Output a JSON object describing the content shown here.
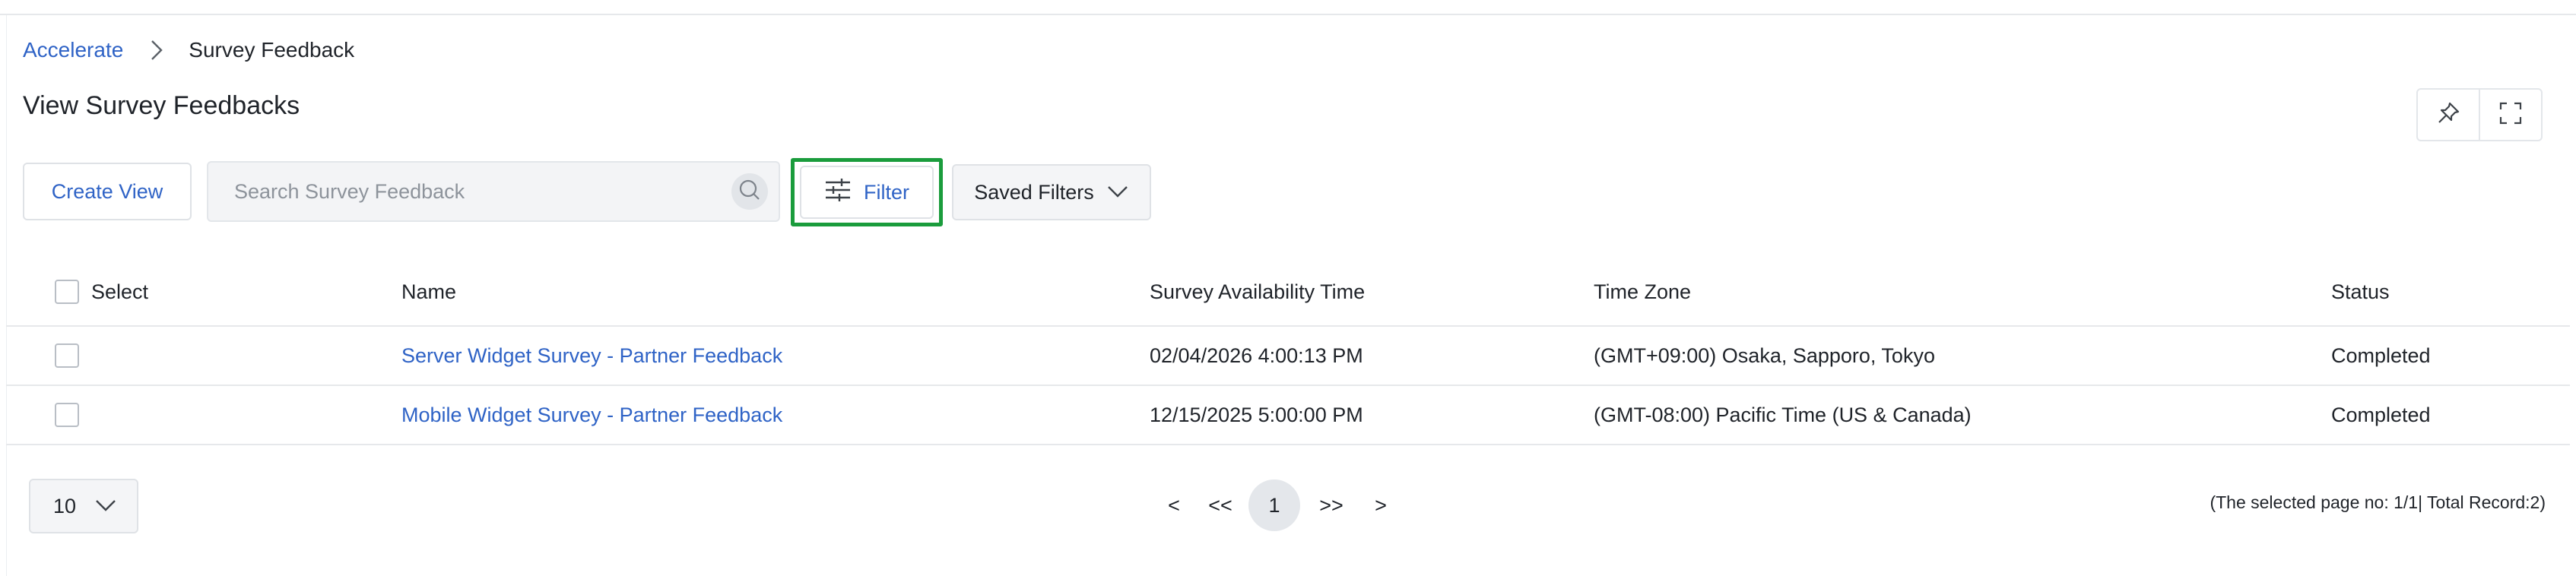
{
  "breadcrumb": {
    "root": "Accelerate",
    "current": "Survey Feedback"
  },
  "page": {
    "title": "View Survey Feedbacks"
  },
  "toolbar": {
    "create_view_label": "Create View",
    "search_placeholder": "Search Survey Feedback",
    "filter_label": "Filter",
    "saved_filters_label": "Saved Filters"
  },
  "table": {
    "headers": {
      "select": "Select",
      "name": "Name",
      "availability": "Survey Availability Time",
      "timezone": "Time Zone",
      "status": "Status"
    },
    "rows": [
      {
        "name": "Server Widget Survey - Partner Feedback",
        "availability": "02/04/2026 4:00:13 PM",
        "timezone": "(GMT+09:00) Osaka, Sapporo, Tokyo",
        "status": "Completed"
      },
      {
        "name": "Mobile Widget Survey - Partner Feedback",
        "availability": "12/15/2025 5:00:00 PM",
        "timezone": "(GMT-08:00) Pacific Time (US & Canada)",
        "status": "Completed"
      }
    ]
  },
  "pagination": {
    "page_size": "10",
    "prev": "<",
    "first": "<<",
    "current": "1",
    "last": ">>",
    "next": ">",
    "record_info": "(The selected page no: 1/1| Total Record:2)"
  },
  "icons": {
    "breadcrumb_separator": "chevron-right-icon",
    "pin": "pin-icon",
    "fullscreen": "fullscreen-icon",
    "search": "search-icon",
    "filter": "sliders-icon",
    "dropdown": "chevron-down-icon"
  },
  "colors": {
    "link": "#2f63c6",
    "highlight": "#1a9c3c",
    "text": "#1f2329"
  }
}
